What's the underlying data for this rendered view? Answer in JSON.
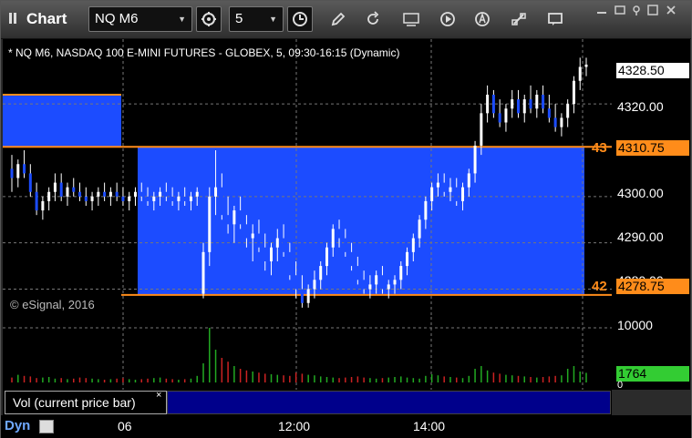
{
  "window": {
    "title": "Chart",
    "symbol": "NQ M6",
    "interval": "5",
    "toolbar_icons": [
      "settings-icon",
      "clock-icon",
      "pencil-icon",
      "refresh-icon",
      "get-icon",
      "play-icon",
      "cursor-icon",
      "link-icon",
      "chat-icon"
    ]
  },
  "chart": {
    "description": "* NQ M6, NASDAQ 100 E-MINI FUTURES - GLOBEX, 5, 09:30-16:15 (Dynamic)",
    "copyright": "© eSignal, 2016",
    "price_labels": [
      "4320.00",
      "4310.00",
      "4300.00",
      "4290.00",
      "4280.00"
    ],
    "last_price": "4328.50",
    "level_43": {
      "num": "43",
      "price": "4310.75"
    },
    "level_42": {
      "num": "42",
      "price": "4278.75"
    }
  },
  "volume": {
    "label": "Vol (current price bar)",
    "close": "×",
    "scale_top": "10000",
    "scale_bottom": "0",
    "current": "1764"
  },
  "xaxis": {
    "ticks": [
      "06",
      "12:00",
      "14:00"
    ],
    "dyn_label": "Dyn"
  },
  "colors": {
    "zone_blue": "#1c4cff",
    "level_orange": "#ff8c1a",
    "candle_up": "#ffffff",
    "candle_down": "#1c4cff",
    "vol_up": "#22aa22",
    "vol_down": "#cc2222",
    "vol_current": "#33cc33"
  },
  "chart_data": {
    "type": "candlestick",
    "ylim": [
      4274,
      4334
    ],
    "levels": [
      4310.75,
      4278.75
    ],
    "bars": [
      [
        4306,
        4309,
        4301,
        4304
      ],
      [
        4304,
        4308,
        4302,
        4307
      ],
      [
        4307,
        4310,
        4304,
        4305
      ],
      [
        4305,
        4307,
        4300,
        4301
      ],
      [
        4301,
        4303,
        4296,
        4297
      ],
      [
        4297,
        4300,
        4295,
        4299
      ],
      [
        4299,
        4302,
        4297,
        4301
      ],
      [
        4301,
        4305,
        4299,
        4303
      ],
      [
        4303,
        4305,
        4299,
        4300
      ],
      [
        4300,
        4303,
        4298,
        4302
      ],
      [
        4302,
        4304,
        4300,
        4301
      ],
      [
        4301,
        4303,
        4299,
        4300
      ],
      [
        4300,
        4302,
        4298,
        4299
      ],
      [
        4299,
        4301,
        4297,
        4300
      ],
      [
        4300,
        4302,
        4298,
        4301
      ],
      [
        4301,
        4303,
        4299,
        4300
      ],
      [
        4300,
        4302,
        4298,
        4301
      ],
      [
        4301,
        4303,
        4299,
        4300
      ],
      [
        4300,
        4302,
        4298,
        4299
      ],
      [
        4299,
        4301,
        4297,
        4300
      ],
      [
        4300,
        4302,
        4298,
        4301
      ],
      [
        4301,
        4303,
        4299,
        4300
      ],
      [
        4300,
        4302,
        4298,
        4299
      ],
      [
        4299,
        4301,
        4297,
        4300
      ],
      [
        4300,
        4302,
        4298,
        4301
      ],
      [
        4301,
        4303,
        4299,
        4300
      ],
      [
        4300,
        4302,
        4298,
        4299
      ],
      [
        4299,
        4301,
        4297,
        4300
      ],
      [
        4300,
        4302,
        4298,
        4299
      ],
      [
        4299,
        4301,
        4297,
        4300
      ],
      [
        4300,
        4302,
        4298,
        4301
      ],
      [
        4279,
        4290,
        4278,
        4288
      ],
      [
        4288,
        4302,
        4285,
        4300
      ],
      [
        4300,
        4310,
        4296,
        4302
      ],
      [
        4302,
        4305,
        4295,
        4296
      ],
      [
        4296,
        4300,
        4292,
        4294
      ],
      [
        4294,
        4298,
        4290,
        4297
      ],
      [
        4297,
        4300,
        4293,
        4294
      ],
      [
        4294,
        4296,
        4289,
        4291
      ],
      [
        4291,
        4294,
        4286,
        4292
      ],
      [
        4292,
        4295,
        4288,
        4289
      ],
      [
        4289,
        4292,
        4284,
        4286
      ],
      [
        4286,
        4290,
        4283,
        4289
      ],
      [
        4289,
        4293,
        4286,
        4291
      ],
      [
        4291,
        4294,
        4287,
        4288
      ],
      [
        4288,
        4290,
        4282,
        4283
      ],
      [
        4283,
        4286,
        4278,
        4280
      ],
      [
        4280,
        4283,
        4276,
        4277
      ],
      [
        4277,
        4281,
        4276,
        4280
      ],
      [
        4280,
        4284,
        4278,
        4282
      ],
      [
        4282,
        4286,
        4280,
        4285
      ],
      [
        4285,
        4290,
        4283,
        4289
      ],
      [
        4289,
        4294,
        4287,
        4293
      ],
      [
        4293,
        4295,
        4289,
        4291
      ],
      [
        4291,
        4293,
        4287,
        4288
      ],
      [
        4288,
        4290,
        4284,
        4285
      ],
      [
        4285,
        4287,
        4281,
        4282
      ],
      [
        4282,
        4284,
        4279,
        4280
      ],
      [
        4280,
        4283,
        4278,
        4281
      ],
      [
        4281,
        4284,
        4279,
        4283
      ],
      [
        4283,
        4285,
        4279,
        4280
      ],
      [
        4280,
        4282,
        4278,
        4281
      ],
      [
        4281,
        4283,
        4279,
        4282
      ],
      [
        4282,
        4286,
        4280,
        4285
      ],
      [
        4285,
        4289,
        4283,
        4288
      ],
      [
        4288,
        4292,
        4286,
        4291
      ],
      [
        4291,
        4296,
        4289,
        4295
      ],
      [
        4295,
        4300,
        4293,
        4299
      ],
      [
        4299,
        4303,
        4297,
        4302
      ],
      [
        4302,
        4305,
        4300,
        4303
      ],
      [
        4303,
        4305,
        4300,
        4301
      ],
      [
        4301,
        4304,
        4299,
        4302
      ],
      [
        4302,
        4304,
        4298,
        4299
      ],
      [
        4299,
        4303,
        4297,
        4302
      ],
      [
        4302,
        4306,
        4300,
        4305
      ],
      [
        4305,
        4312,
        4303,
        4311
      ],
      [
        4311,
        4320,
        4309,
        4318
      ],
      [
        4318,
        4324,
        4316,
        4322
      ],
      [
        4322,
        4323,
        4317,
        4318
      ],
      [
        4318,
        4321,
        4315,
        4316
      ],
      [
        4316,
        4320,
        4314,
        4319
      ],
      [
        4319,
        4323,
        4317,
        4321
      ],
      [
        4321,
        4323,
        4317,
        4318
      ],
      [
        4318,
        4322,
        4316,
        4321
      ],
      [
        4321,
        4324,
        4318,
        4319
      ],
      [
        4319,
        4323,
        4317,
        4322
      ],
      [
        4322,
        4324,
        4318,
        4319
      ],
      [
        4319,
        4322,
        4316,
        4317
      ],
      [
        4317,
        4320,
        4314,
        4315
      ],
      [
        4315,
        4318,
        4313,
        4317
      ],
      [
        4317,
        4321,
        4315,
        4320
      ],
      [
        4320,
        4326,
        4318,
        4325
      ],
      [
        4325,
        4330,
        4323,
        4328
      ],
      [
        4328,
        4330,
        4326,
        4328.5
      ]
    ],
    "volume": [
      900,
      1400,
      1200,
      1100,
      800,
      900,
      1000,
      700,
      800,
      600,
      700,
      900,
      800,
      700,
      600,
      500,
      600,
      700,
      800,
      600,
      500,
      600,
      700,
      800,
      900,
      700,
      600,
      500,
      600,
      700,
      1200,
      3500,
      10000,
      6000,
      4500,
      3800,
      3000,
      2500,
      2200,
      2000,
      1800,
      1600,
      1500,
      1400,
      1300,
      1200,
      1800,
      1600,
      1400,
      1300,
      1100,
      1000,
      900,
      800,
      900,
      1000,
      1100,
      900,
      800,
      700,
      800,
      900,
      1000,
      1100,
      900,
      800,
      700,
      1200,
      1500,
      1300,
      1100,
      1000,
      900,
      800,
      1200,
      2500,
      3000,
      2200,
      1800,
      1600,
      1400,
      1300,
      1200,
      1100,
      1000,
      900,
      1000,
      1100,
      1200,
      1300,
      2500,
      3000,
      2000,
      1764
    ]
  }
}
